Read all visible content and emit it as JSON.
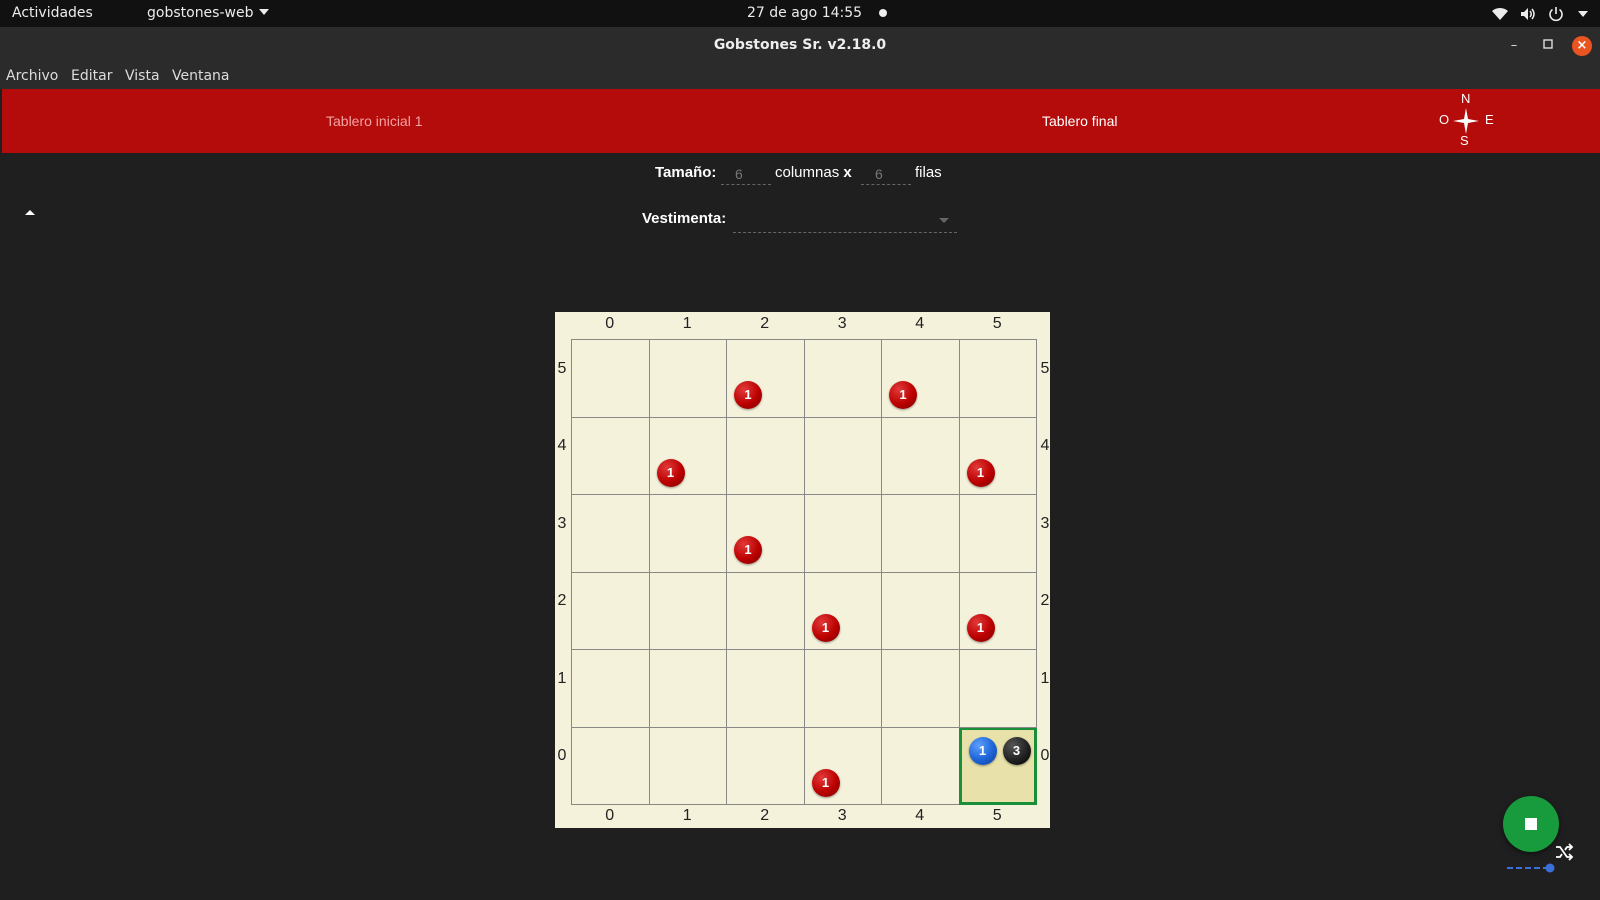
{
  "system_bar": {
    "activities": "Actividades",
    "app_menu": "gobstones-web",
    "clock": "27 de ago  14:55"
  },
  "window": {
    "title": "Gobstones Sr. v2.18.0"
  },
  "menubar": {
    "items": [
      "Archivo",
      "Editar",
      "Vista",
      "Ventana"
    ]
  },
  "header": {
    "tab_initial": "Tablero inicial 1",
    "tab_final": "Tablero final",
    "compass": {
      "n": "N",
      "s": "S",
      "e": "E",
      "w": "O"
    }
  },
  "controls": {
    "size_label": "Tamaño:",
    "columns_value": "6",
    "columns_label": "columnas",
    "times": "x",
    "rows_value": "6",
    "rows_label": "filas",
    "outfit_label": "Vestimenta:",
    "outfit_value": ""
  },
  "board": {
    "columns": 6,
    "rows": 6,
    "col_labels": [
      "0",
      "1",
      "2",
      "3",
      "4",
      "5"
    ],
    "row_labels": [
      "0",
      "1",
      "2",
      "3",
      "4",
      "5"
    ],
    "head": {
      "x": 5,
      "y": 0
    },
    "stones": [
      {
        "x": 2,
        "y": 5,
        "color": "red",
        "count": "1"
      },
      {
        "x": 4,
        "y": 5,
        "color": "red",
        "count": "1"
      },
      {
        "x": 1,
        "y": 4,
        "color": "red",
        "count": "1"
      },
      {
        "x": 5,
        "y": 4,
        "color": "red",
        "count": "1"
      },
      {
        "x": 2,
        "y": 3,
        "color": "red",
        "count": "1"
      },
      {
        "x": 3,
        "y": 2,
        "color": "red",
        "count": "1"
      },
      {
        "x": 5,
        "y": 2,
        "color": "red",
        "count": "1"
      },
      {
        "x": 3,
        "y": 0,
        "color": "red",
        "count": "1"
      },
      {
        "x": 5,
        "y": 0,
        "color": "blue",
        "count": "1"
      },
      {
        "x": 5,
        "y": 0,
        "color": "black",
        "count": "3"
      }
    ]
  },
  "colors": {
    "header_red": "#b40b0b",
    "board_bg": "#f5f2dc",
    "head_border": "#1a8f3a",
    "run_button": "#179b3d"
  },
  "icons": {
    "run_button": "stop-icon",
    "shuffle": "shuffle-icon",
    "collapse": "caret-up-icon"
  }
}
